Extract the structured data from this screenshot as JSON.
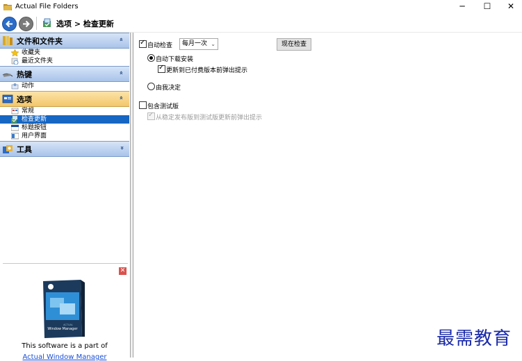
{
  "window": {
    "title": "Actual File Folders",
    "controls": {
      "minimize": "─",
      "maximize": "☐",
      "close": "✕"
    }
  },
  "navbar": {
    "breadcrumb": "选项 > 检查更新"
  },
  "sidebar": {
    "groups": [
      {
        "label": "文件和文件夹",
        "icon": "folder-icon",
        "chevron": "»",
        "items": [
          {
            "label": "收藏夹",
            "icon": "star-icon"
          },
          {
            "label": "最近文件夹",
            "icon": "recent-folder-icon"
          }
        ]
      },
      {
        "label": "热键",
        "icon": "keyboard-icon",
        "chevron": "»",
        "items": [
          {
            "label": "动作",
            "icon": "action-icon"
          }
        ]
      },
      {
        "label": "选项",
        "icon": "options-icon",
        "chevron": "»",
        "items": [
          {
            "label": "常规",
            "icon": "general-icon"
          },
          {
            "label": "检查更新",
            "icon": "update-icon",
            "selected": true
          },
          {
            "label": "标题按钮",
            "icon": "title-button-icon"
          },
          {
            "label": "用户界面",
            "icon": "ui-icon"
          }
        ]
      },
      {
        "label": "工具",
        "icon": "tools-icon",
        "chevron": "»",
        "items": []
      }
    ],
    "promo": {
      "close": "✕",
      "box_brand": "ACTUAL",
      "box_product": "Window Manager",
      "text": "This software is a part of",
      "link": "Actual Window Manager"
    }
  },
  "content": {
    "auto_check": {
      "label": "自动检查",
      "checked": true
    },
    "frequency": {
      "value": "每月一次",
      "arrow": "⌄"
    },
    "check_now_button": "现在检查",
    "auto_download": {
      "label": "自动下载安装",
      "checked": true
    },
    "notify_paid": {
      "label": "更新到已付费版本前弹出提示",
      "checked": true
    },
    "manual": {
      "label": "由我决定",
      "checked": false
    },
    "include_beta": {
      "label": "包含测试版",
      "checked": false
    },
    "beta_notify": {
      "label": "从稳定发布版到测试版更新前弹出提示",
      "checked": true,
      "disabled": true
    }
  },
  "watermark": "最需教育",
  "colors": {
    "selected": "#1666c4",
    "group_header_blue": "#a9c4ea",
    "group_header_orange": "#f3c66b",
    "link": "#1a4fd6",
    "watermark": "#1a2aa8"
  }
}
